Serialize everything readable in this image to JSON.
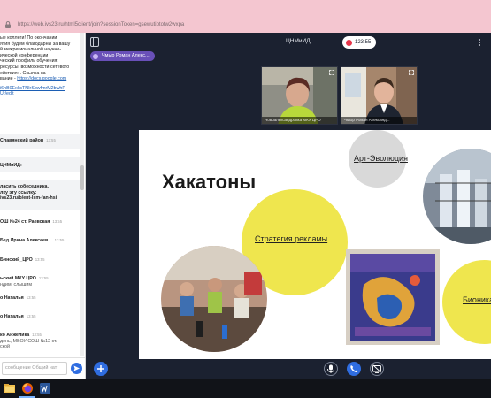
{
  "browser": {
    "url": "https://web.ivs23.ru/html5client/join?sessionToken=gsewutiptotw2wxpa"
  },
  "chat": {
    "messages": [
      {
        "lines": [
          "ые коллеги! По окончании",
          "ятия будем благодарны за вашу",
          "й межрегиональной научно-",
          "ической конференции",
          "ческий профиль обучения:",
          "ресурсы, возможности сетевого",
          "ействия». Ссылка на"
        ],
        "link_prefix": "вание - ",
        "link": "https://docs.google.com",
        "extra_links": [
          "i6hB0ExltsTNIrSbwfmrM2bwhP",
          "Ur/edit"
        ]
      },
      {
        "name": "Славянский район",
        "time": "13:55"
      },
      {
        "name": "ЦНМиИД:",
        "time": ""
      },
      {
        "lines_bold": [
          "ласить собеседника,",
          "лку эту ссылку:",
          "ivs23.ru/b/ent-lsm-fan-hsi"
        ]
      },
      {
        "name": "ОШ №24 ст. Раевская",
        "time": "13:55"
      },
      {
        "name": "Бед Ирина Алексеев...",
        "time": "13:55"
      },
      {
        "name": "Бинский_ЦРО",
        "time": "13:55"
      },
      {
        "name": "ьский МКУ ЦРО",
        "time": "13:55",
        "sub": "ндим, слышим"
      },
      {
        "name": "о Наталья",
        "time": "13:55"
      },
      {
        "name": "о Наталья",
        "time": "13:55"
      },
      {
        "name": "ко Анжелика",
        "time": "13:55",
        "sub": "день, МБОУ СОШ №12 ст.",
        "sub2": "ской"
      }
    ],
    "input_placeholder": "сообщение Общий чат"
  },
  "conference": {
    "title": "ЦНМиИД",
    "rec_time": "123:55",
    "speaker_chip": "Чмыр Роман Алекс...",
    "tiles": [
      {
        "caption": "Новоалександровка МКУ ЦРО"
      },
      {
        "caption": "Чмыр Роман Александ..."
      }
    ]
  },
  "slide": {
    "title": "Хакатоны",
    "labels": {
      "art": "Арт-Эволюция",
      "strategy": "Стратегия рекламы",
      "bionics": "Бионика"
    }
  },
  "icons": {
    "tiles_expand": "expand-icon",
    "send": "send-icon",
    "plus": "plus-icon",
    "mic": "microphone-icon",
    "phone": "phone-icon",
    "screen": "screen-share-icon"
  },
  "colors": {
    "accent": "#2f6de1",
    "slide_yellow": "#efe64e",
    "slide_grey": "#d9d9d9",
    "chip_purple": "#6950b8"
  }
}
